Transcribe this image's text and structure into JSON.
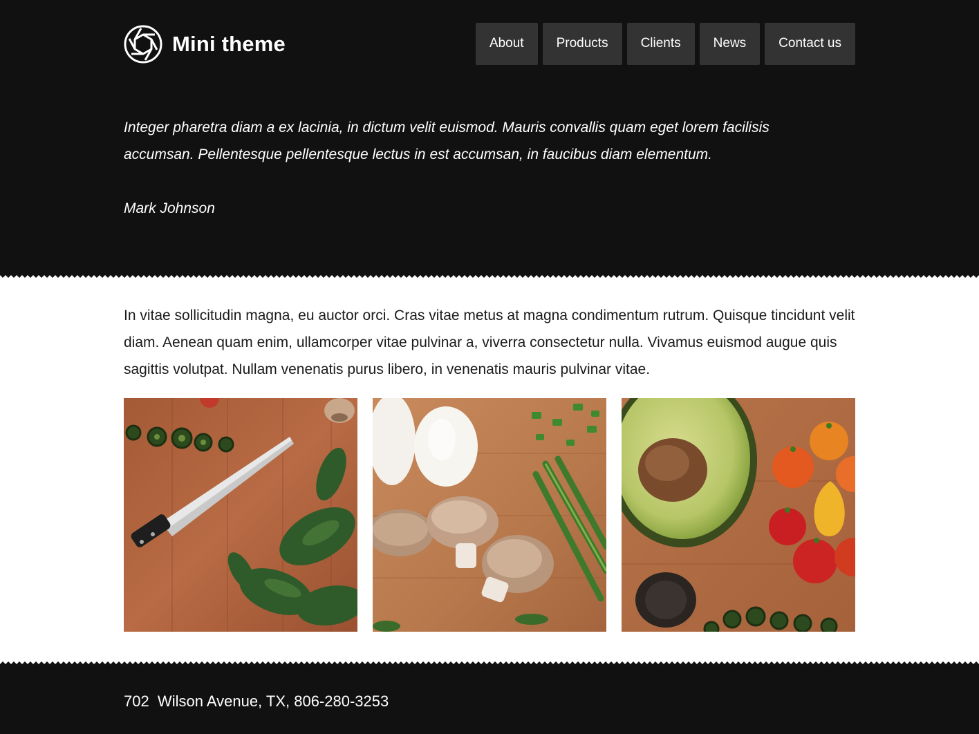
{
  "header": {
    "site_title": "Mini theme",
    "logo_icon": "camera-aperture-icon",
    "nav": [
      {
        "label": "About"
      },
      {
        "label": "Products"
      },
      {
        "label": "Clients"
      },
      {
        "label": "News"
      },
      {
        "label": "Contact us"
      }
    ]
  },
  "testimonial": {
    "quote": "Integer pharetra diam a ex lacinia, in dictum velit euismod. Mauris convallis quam eget lorem facilisis accumsan. Pellentesque pellentesque lectus in est accumsan, in faucibus diam elementum.",
    "author": "Mark Johnson"
  },
  "main": {
    "paragraph": "In vitae sollicitudin magna, eu auctor orci. Cras vitae metus at magna condimentum rutrum. Quisque tincidunt velit diam. Aenean quam enim, ullamcorper vitae pulvinar a, viverra consectetur nulla. Vivamus euismod augue quis sagittis volutpat. Nullam venenatis purus libero, in venenatis mauris pulvinar vitae."
  },
  "footer": {
    "address": "702  Wilson Avenue, TX, 806-280-3253"
  },
  "colors": {
    "dark_band": "#111111",
    "nav_button": "#333333"
  }
}
